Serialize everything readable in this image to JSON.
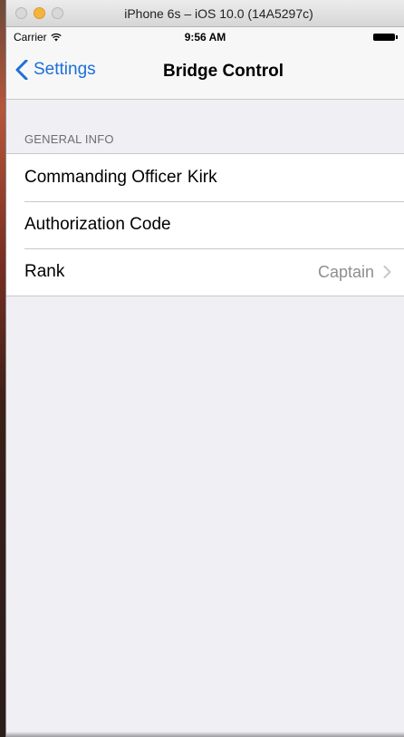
{
  "window": {
    "title": "iPhone 6s – iOS 10.0 (14A5297c)"
  },
  "status_bar": {
    "carrier": "Carrier",
    "time": "9:56 AM"
  },
  "nav": {
    "back_label": "Settings",
    "title": "Bridge Control"
  },
  "section": {
    "header": "GENERAL INFO",
    "rows": [
      {
        "label": "Commanding Officer",
        "value": "Kirk"
      },
      {
        "label": "Authorization Code",
        "value": ""
      },
      {
        "label": "Rank",
        "detail": "Captain"
      }
    ]
  },
  "colors": {
    "accent": "#1d6fd8",
    "background": "#efeff4",
    "separator": "#c8c7cc",
    "detail_text": "#8e8e93"
  }
}
